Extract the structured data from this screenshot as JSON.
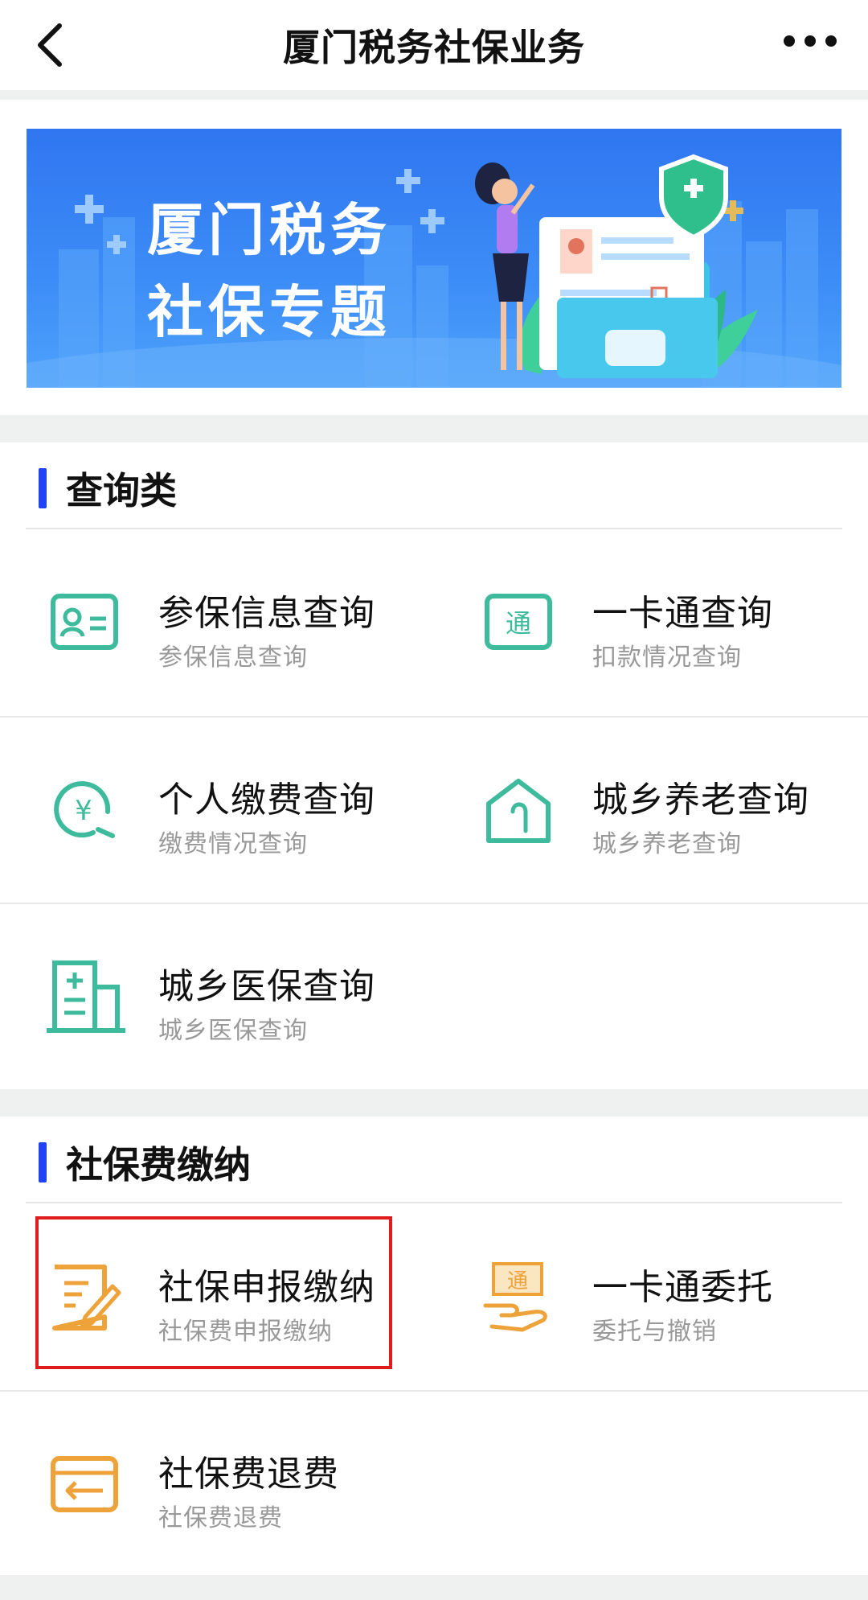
{
  "header": {
    "title": "厦门税务社保业务"
  },
  "banner": {
    "line1": "厦门税务",
    "line2": "社保专题"
  },
  "sections": [
    {
      "title": "查询类",
      "items": [
        {
          "title": "参保信息查询",
          "subtitle": "参保信息查询",
          "icon": "id-card-icon"
        },
        {
          "title": "一卡通查询",
          "subtitle": "扣款情况查询",
          "icon": "tong-badge-icon",
          "icon_text": "通"
        },
        {
          "title": "个人缴费查询",
          "subtitle": "缴费情况查询",
          "icon": "yuan-search-icon",
          "icon_text": "¥"
        },
        {
          "title": "城乡养老查询",
          "subtitle": "城乡养老查询",
          "icon": "house-cane-icon"
        },
        {
          "title": "城乡医保查询",
          "subtitle": "城乡医保查询",
          "icon": "hospital-icon"
        }
      ]
    },
    {
      "title": "社保费缴纳",
      "items": [
        {
          "title": "社保申报缴纳",
          "subtitle": "社保费申报缴纳",
          "icon": "edit-doc-icon"
        },
        {
          "title": "一卡通委托",
          "subtitle": "委托与撤销",
          "icon": "hand-tong-icon",
          "icon_text": "通"
        },
        {
          "title": "社保费退费",
          "subtitle": "社保费退费",
          "icon": "refund-card-icon"
        }
      ]
    }
  ],
  "colors": {
    "teal": "#3dbb9c",
    "orange": "#eda23a",
    "accent_bar": "#1f43f5",
    "highlight": "#e01c1c"
  }
}
